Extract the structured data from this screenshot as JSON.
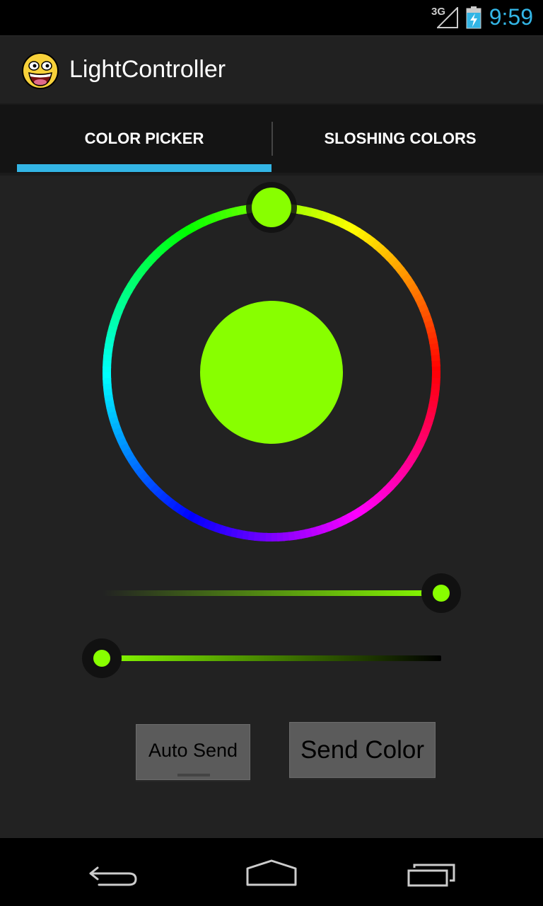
{
  "status_bar": {
    "network_label": "3G",
    "time": "9:59",
    "icons": [
      "signal-icon",
      "battery-charging-icon"
    ]
  },
  "action_bar": {
    "title": "LightController",
    "icon": "awesome-face-icon"
  },
  "tabs": [
    {
      "label": "COLOR PICKER",
      "selected": true
    },
    {
      "label": "SLOSHING COLORS",
      "selected": false
    }
  ],
  "picker": {
    "selected_color": "#88ff00",
    "hue_degrees": 90,
    "saturation_fraction": 1.0,
    "value_fraction": 0.0
  },
  "buttons": {
    "auto_send_label": "Auto Send",
    "send_color_label": "Send Color"
  },
  "colors": {
    "accent": "#33b5e5",
    "background": "#222222"
  },
  "nav_bar": {
    "icons": [
      "back-icon",
      "home-icon",
      "recent-apps-icon"
    ]
  }
}
